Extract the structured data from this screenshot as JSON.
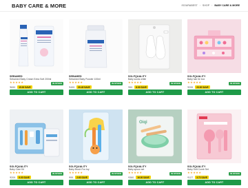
{
  "header": {
    "title": "BABY CARE & MORE",
    "breadcrumb": [
      "ISOURABEST",
      "SHOP",
      "BABY CARE & MORE"
    ]
  },
  "products": [
    {
      "brand": "SEBAMED",
      "name": "Sebamed Baby Cream Extra Soft 200ml",
      "stock": "IN STOCK",
      "price": "₹690",
      "discount": "15.00 SAVE",
      "button": "ADD TO CART"
    },
    {
      "brand": "SEBAMED",
      "name": "Sebamed Baby Powder 100ml",
      "stock": "IN STOCK",
      "price": "₹499",
      "discount": "20.45 SAVE",
      "button": "ADD TO CART"
    },
    {
      "brand": "SOLFQUALITY",
      "name": "Baby socks white",
      "stock": "IN STOCK",
      "price": "₹90",
      "discount": "8.00 SAVE",
      "button": "ADD TO CART"
    },
    {
      "brand": "SOLFQUALITY",
      "name": "Baby hair tie box",
      "stock": "IN STOCK",
      "price": "₹299",
      "discount": "23.00 SAVE",
      "button": "ADD TO CART"
    },
    {
      "brand": "SOLFQUALITY",
      "name": "Baby Care Kit",
      "stock": "IN STOCK",
      "price": "₹209",
      "discount": "9.00 SAVE",
      "button": "ADD TO CART"
    },
    {
      "brand": "SOLFQUALITY",
      "name": "Baby Brush Fox toy",
      "stock": "IN STOCK",
      "price": "₹99",
      "discount": "2.60 SAVE",
      "button": "ADD TO CART"
    },
    {
      "brand": "SOLFQUALITY",
      "name": "Baby spoon set",
      "stock": "IN STOCK",
      "price": "₹360",
      "discount": "16.00 SAVE",
      "button": "ADD TO CART"
    },
    {
      "brand": "SOLFQUALITY",
      "name": "Baby Soft Comb Set",
      "stock": "IN STOCK",
      "price": "₹127",
      "discount": "3.72 SAVE",
      "button": "ADD TO CART"
    }
  ],
  "rating_icon": "star-icon",
  "colors": {
    "button": "#1e9a48",
    "stock": "#2e9e4b",
    "discount": "#f3d400",
    "star": "#f5a623"
  }
}
